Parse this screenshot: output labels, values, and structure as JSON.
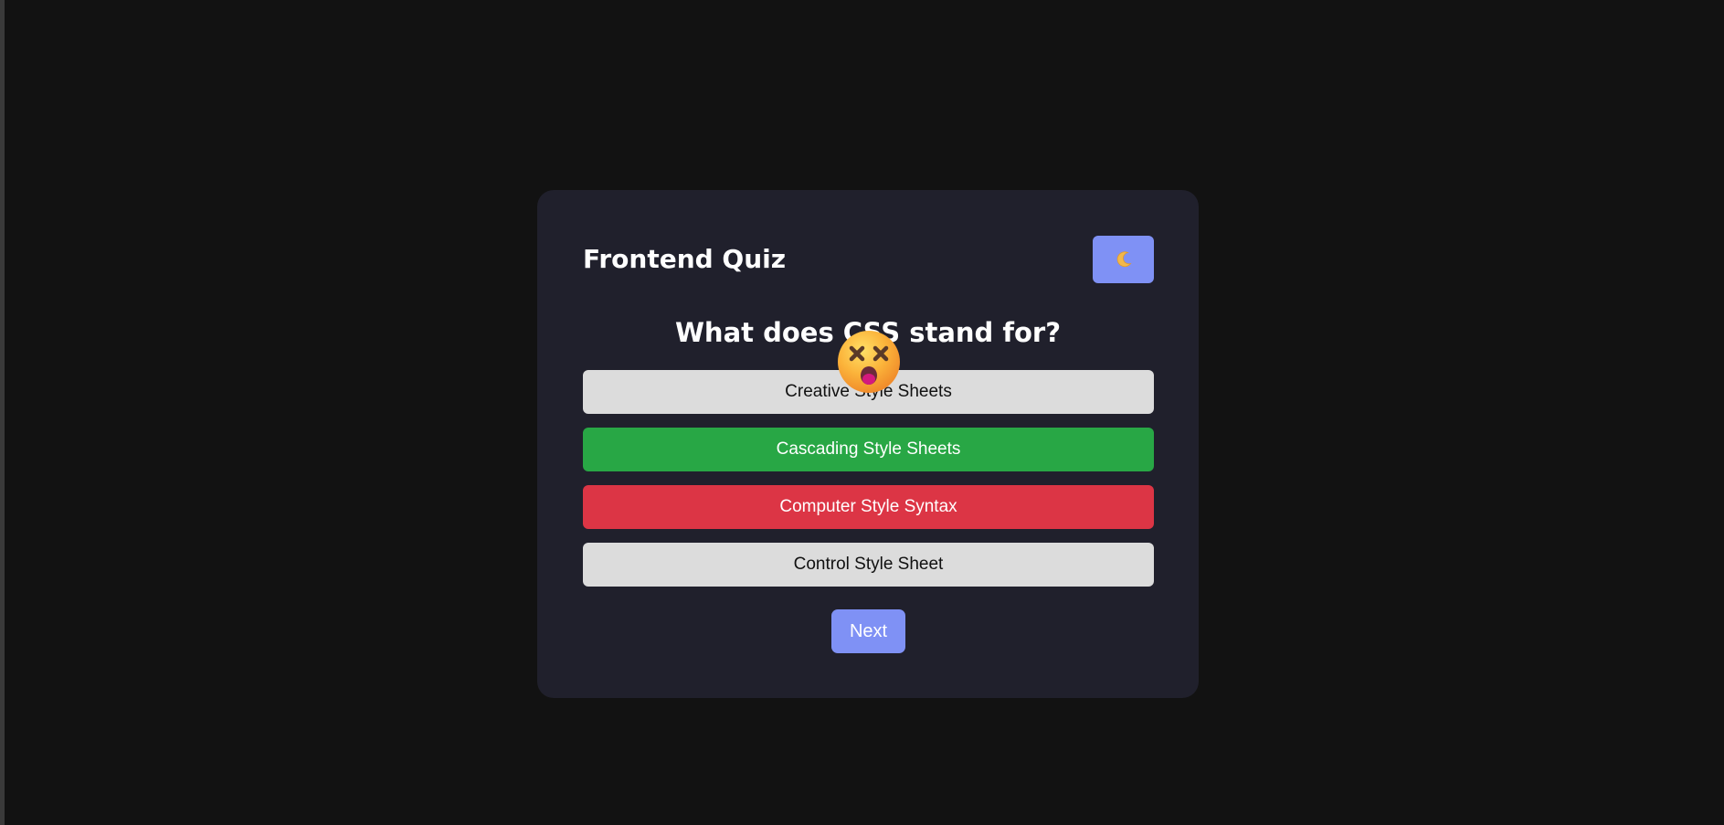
{
  "app": {
    "title": "Frontend Quiz",
    "theme_toggle_icon": "crescent-moon-icon"
  },
  "quiz": {
    "question": "What does CSS stand for?",
    "options": [
      {
        "label": "Creative Style Sheets",
        "state": "default"
      },
      {
        "label": "Cascading Style Sheets",
        "state": "correct"
      },
      {
        "label": "Computer Style Syntax",
        "state": "wrong"
      },
      {
        "label": "Control Style Sheet",
        "state": "default"
      }
    ],
    "next_label": "Next"
  },
  "feedback": {
    "icon": "dizzy-face-emoji-icon"
  },
  "colors": {
    "page_bg": "#121212",
    "card_bg": "#20202c",
    "accent": "#7f91f5",
    "correct": "#28a745",
    "wrong": "#dc3545",
    "option_default": "#dcdcdc"
  }
}
